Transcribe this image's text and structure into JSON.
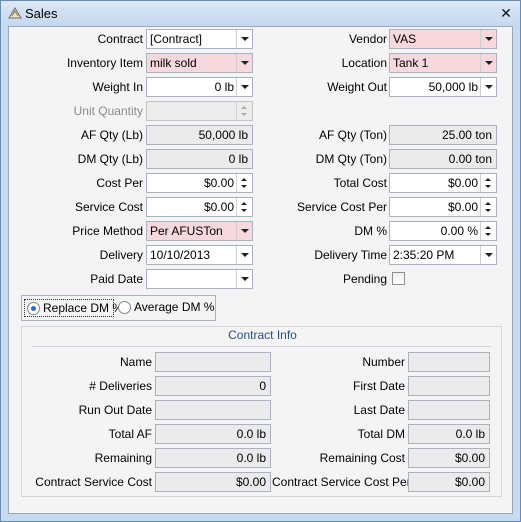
{
  "window": {
    "title": "Sales"
  },
  "left": {
    "contract": {
      "label": "Contract",
      "value": "[Contract]"
    },
    "inventory_item": {
      "label": "Inventory Item",
      "value": "milk sold"
    },
    "weight_in": {
      "label": "Weight In",
      "value": "0 lb"
    },
    "unit_quantity": {
      "label": "Unit Quantity",
      "value": ""
    },
    "af_qty_lb": {
      "label": "AF Qty (Lb)",
      "value": "50,000 lb"
    },
    "dm_qty_lb": {
      "label": "DM Qty (Lb)",
      "value": "0 lb"
    },
    "cost_per": {
      "label": "Cost Per",
      "value": "$0.00"
    },
    "service_cost": {
      "label": "Service Cost",
      "value": "$0.00"
    },
    "price_method": {
      "label": "Price Method",
      "value": "Per AFUSTon"
    },
    "delivery": {
      "label": "Delivery",
      "value": "10/10/2013"
    },
    "paid_date": {
      "label": "Paid Date",
      "value": ""
    }
  },
  "right": {
    "vendor": {
      "label": "Vendor",
      "value": "VAS"
    },
    "location": {
      "label": "Location",
      "value": "Tank 1"
    },
    "weight_out": {
      "label": "Weight Out",
      "value": "50,000 lb"
    },
    "af_qty_ton": {
      "label": "AF Qty (Ton)",
      "value": "25.00 ton"
    },
    "dm_qty_ton": {
      "label": "DM Qty (Ton)",
      "value": "0.00 ton"
    },
    "total_cost": {
      "label": "Total Cost",
      "value": "$0.00"
    },
    "service_cost_per": {
      "label": "Service Cost Per",
      "value": "$0.00"
    },
    "dm_percent": {
      "label": "DM %",
      "value": "0.00 %"
    },
    "delivery_time": {
      "label": "Delivery Time",
      "value": "2:35:20 PM"
    },
    "pending": {
      "label": "Pending",
      "checked": false
    }
  },
  "dm_mode": {
    "options": [
      {
        "label": "Replace DM %",
        "selected": true
      },
      {
        "label": "Average DM %",
        "selected": false
      }
    ]
  },
  "contract_info": {
    "title": "Contract Info",
    "left": [
      {
        "label": "Name",
        "value": ""
      },
      {
        "label": "# Deliveries",
        "value": "0"
      },
      {
        "label": "Run Out Date",
        "value": ""
      },
      {
        "label": "Total AF",
        "value": "0.0 lb"
      },
      {
        "label": "Remaining",
        "value": "0.0 lb"
      },
      {
        "label": "Contract Service Cost",
        "value": "$0.00"
      }
    ],
    "right": [
      {
        "label": "Number",
        "value": ""
      },
      {
        "label": "First Date",
        "value": ""
      },
      {
        "label": "Last Date",
        "value": ""
      },
      {
        "label": "Total DM",
        "value": "0.0 lb"
      },
      {
        "label": "Remaining Cost",
        "value": "$0.00"
      },
      {
        "label": "Contract Service Cost Per",
        "value": "$0.00"
      }
    ]
  },
  "icons": {
    "title": "sales-app-icon",
    "close": "close-icon",
    "dropdown": "chevron-down-icon",
    "spin": "spinner-icon"
  },
  "colors": {
    "required_field": "#f7d8dc",
    "readonly_field": "#ebebeb",
    "frame": "#c7dbef",
    "group_title": "#2a4f86"
  }
}
